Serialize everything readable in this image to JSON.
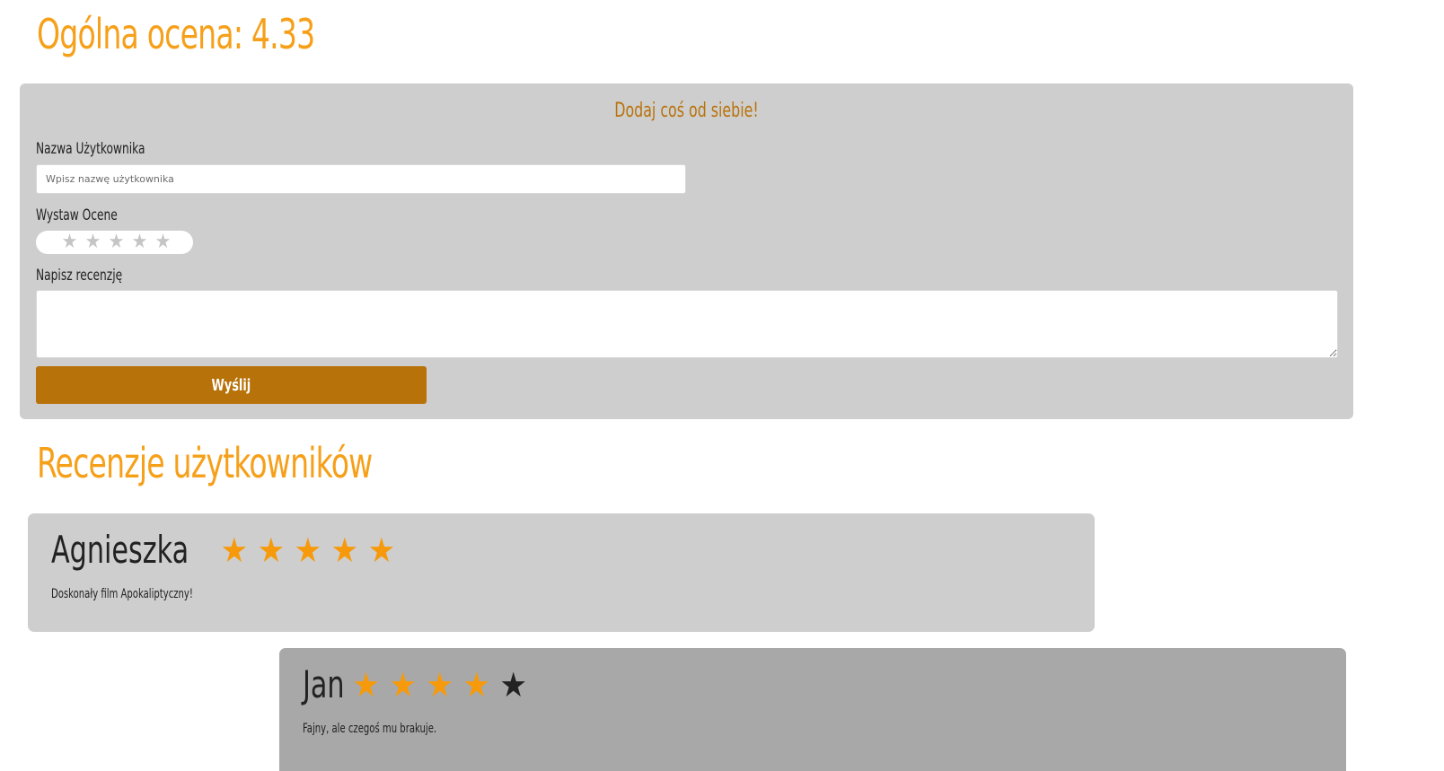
{
  "overall": {
    "label": "Ogólna ocena: 4.33",
    "value": 4.33
  },
  "form": {
    "title": "Dodaj coś od siebie!",
    "username_label": "Nazwa Użytkownika",
    "username_placeholder": "Wpisz nazwę użytkownika",
    "username_value": "",
    "rating_label": "Wystaw Ocene",
    "rating_max": 5,
    "rating_selected": 0,
    "rating_star_glyph": "★",
    "review_label": "Napisz recenzję",
    "review_value": "",
    "submit_label": "Wyślij"
  },
  "reviews_heading": "Recenzje użytkowników",
  "reviews": [
    {
      "name": "Agnieszka",
      "rating": 5,
      "max": 5,
      "text": "Doskonały film Apokaliptyczny!"
    },
    {
      "name": "Jan",
      "rating": 4,
      "max": 5,
      "text": "Fajny, ale czegoś mu brakuje."
    }
  ],
  "colors": {
    "accent": "#f6a01a",
    "star_on": "#f69a0c",
    "star_off": "#222222",
    "button": "#b8720a",
    "card_light": "#cecece",
    "card_dark": "#a8a8a8"
  }
}
